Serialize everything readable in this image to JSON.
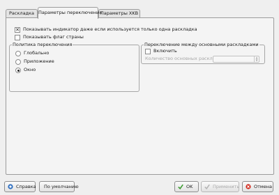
{
  "tabs": [
    {
      "label": "Раскладка"
    },
    {
      "label": "Параметры переключения"
    },
    {
      "label": "Параметры XKB"
    }
  ],
  "options": {
    "show_indicator": {
      "label": "Показывать индикатор даже если используется только одна раскладка",
      "checked": true
    },
    "show_flag": {
      "label": "Показывать флаг страны",
      "checked": false
    }
  },
  "policy_group": {
    "title": "Политика переключения",
    "items": [
      {
        "label": "Глобально",
        "selected": false
      },
      {
        "label": "Приложение",
        "selected": false
      },
      {
        "label": "Окно",
        "selected": true
      }
    ]
  },
  "switching_group": {
    "title": "Переключение между основными раскладками",
    "enable_label": "Включить",
    "count_label": "Количество основных раскладок:",
    "count_value": ""
  },
  "buttons": {
    "help": "Справка",
    "defaults": "По умолчанию",
    "ok": "OK",
    "apply": "Применить",
    "cancel": "Отмена"
  },
  "colors": {
    "help_icon": "#2f6fc0",
    "ok_icon": "#3a9a2e",
    "cancel_icon": "#d12a1d"
  }
}
